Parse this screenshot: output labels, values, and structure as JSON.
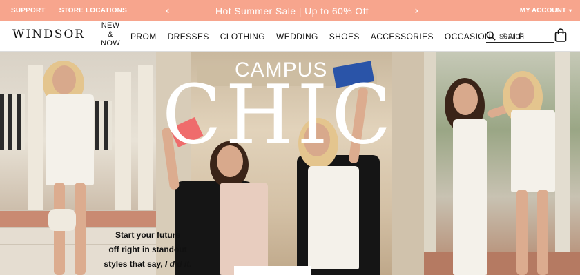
{
  "promo": {
    "support": "SUPPORT",
    "store_locations": "STORE LOCATIONS",
    "message": "Hot Summer Sale | Up to 60% Off",
    "prev": "‹",
    "next": "›",
    "account": "MY ACCOUNT",
    "account_caret": "▾"
  },
  "nav": {
    "logo": "WINDSOR",
    "new_now": [
      "NEW",
      "&",
      "NOW"
    ],
    "items": [
      "PROM",
      "DRESSES",
      "CLOTHING",
      "WEDDING",
      "SHOES",
      "ACCESSORIES",
      "OCCASION",
      "SALE"
    ],
    "search_placeholder": "search",
    "icons": {
      "search": "search-icon",
      "bag": "shopping-bag-icon"
    }
  },
  "hero": {
    "headline_small": "CAMPUS",
    "headline_large": "CHIC",
    "tagline_lines": [
      "Start your future",
      "off right in standout"
    ],
    "tagline_last_prefix": "styles that say, ",
    "tagline_last_em": "I did it."
  },
  "colors": {
    "promo_bg": "#f7a58d",
    "promo_text": "#ffffff",
    "text": "#111111"
  }
}
